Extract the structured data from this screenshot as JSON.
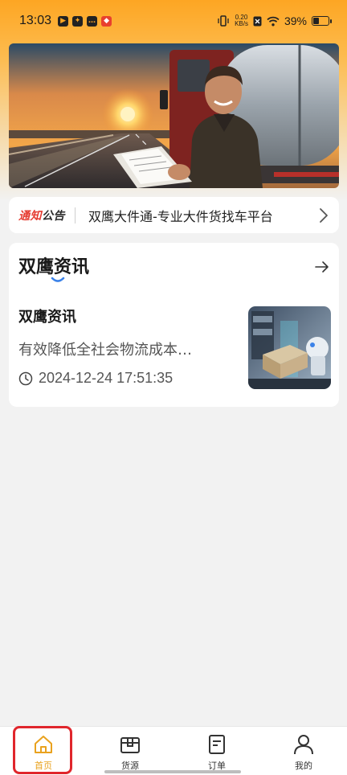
{
  "status_bar": {
    "time": "13:03",
    "net_speed_value": "0.20",
    "net_speed_unit": "KB/s",
    "battery_percent": "39%",
    "battery_level": 0.39,
    "app_icons": [
      "play-store-icon",
      "app-swirl-icon",
      "chat-bubble-icon",
      "red-app-icon"
    ]
  },
  "banner": {
    "description_icon": "truck-driver-sunset-photo"
  },
  "notice": {
    "tag_part1": "通知",
    "tag_part2": "公告",
    "text": "双鹰大件通-专业大件货找车平台"
  },
  "news": {
    "section_title": "双鹰资讯",
    "item": {
      "title": "双鹰资讯",
      "description": "有效降低全社会物流成本…",
      "time": "2024-12-24 17:51:35"
    }
  },
  "tabbar": {
    "tabs": [
      {
        "label": "首页",
        "icon": "home-icon",
        "active": true
      },
      {
        "label": "货源",
        "icon": "cargo-box-icon",
        "active": false
      },
      {
        "label": "订单",
        "icon": "order-document-icon",
        "active": false
      },
      {
        "label": "我的",
        "icon": "user-profile-icon",
        "active": false
      }
    ]
  },
  "colors": {
    "brand_orange": "#fda623",
    "active_tab": "#e9a21e",
    "notice_red": "#e53a2f",
    "highlight_red": "#e0262c"
  }
}
